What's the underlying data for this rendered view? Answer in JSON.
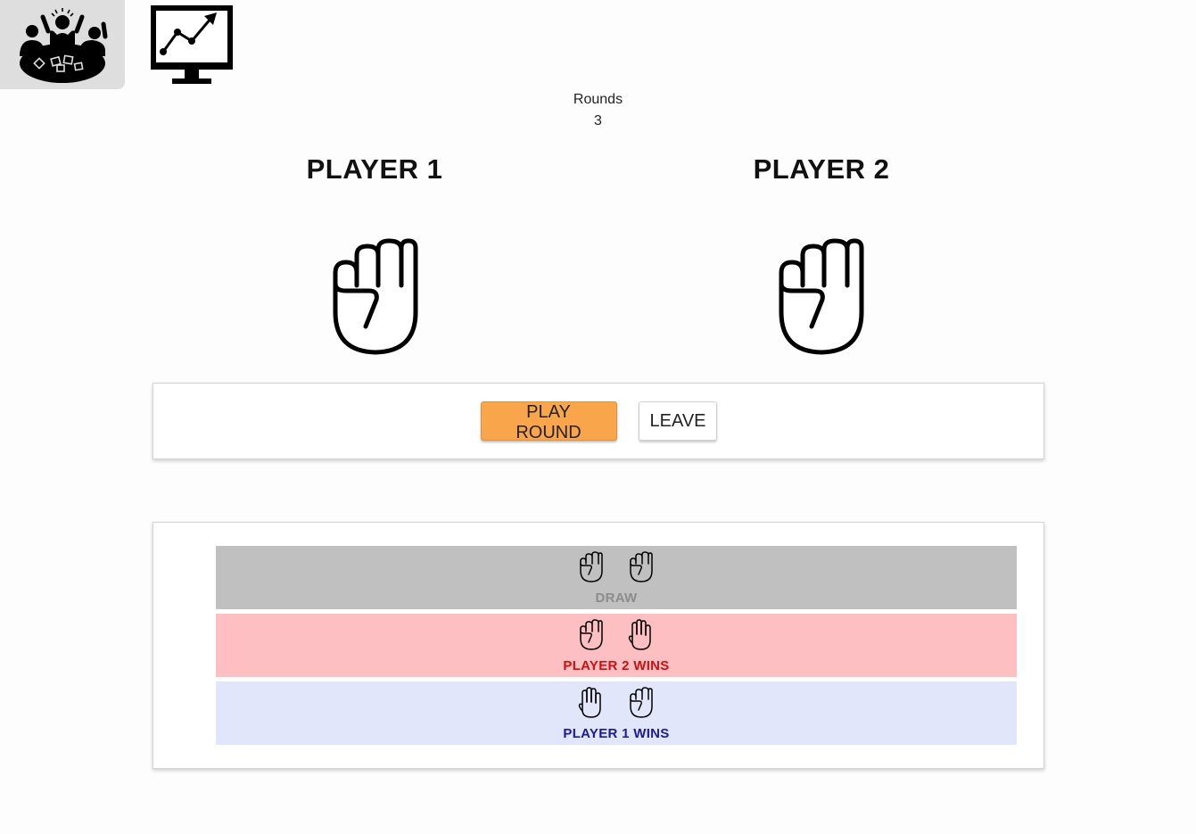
{
  "nav": {
    "group_icon": "group-game-icon",
    "stats_icon": "monitor-chart-icon"
  },
  "rounds": {
    "label": "Rounds",
    "value": "3"
  },
  "players": {
    "p1": {
      "title": "PLAYER 1",
      "hand_icon": "rock-fist-icon"
    },
    "p2": {
      "title": "PLAYER 2",
      "hand_icon": "rock-fist-icon"
    }
  },
  "controls": {
    "play_label": "PLAY ROUND",
    "leave_label": "LEAVE",
    "play_color": "#f9a54c"
  },
  "history": [
    {
      "p1_hand": "rock",
      "p2_hand": "rock",
      "result": "DRAW",
      "bg": "#c0c0c0",
      "color": "#8c8c8c"
    },
    {
      "p1_hand": "rock",
      "p2_hand": "paper",
      "result": "PLAYER 2 WINS",
      "bg": "#fdbfc1",
      "color": "#d01010"
    },
    {
      "p1_hand": "paper",
      "p2_hand": "rock",
      "result": "PLAYER 1 WINS",
      "bg": "#e2e6fb",
      "color": "#1a1a9a"
    }
  ]
}
